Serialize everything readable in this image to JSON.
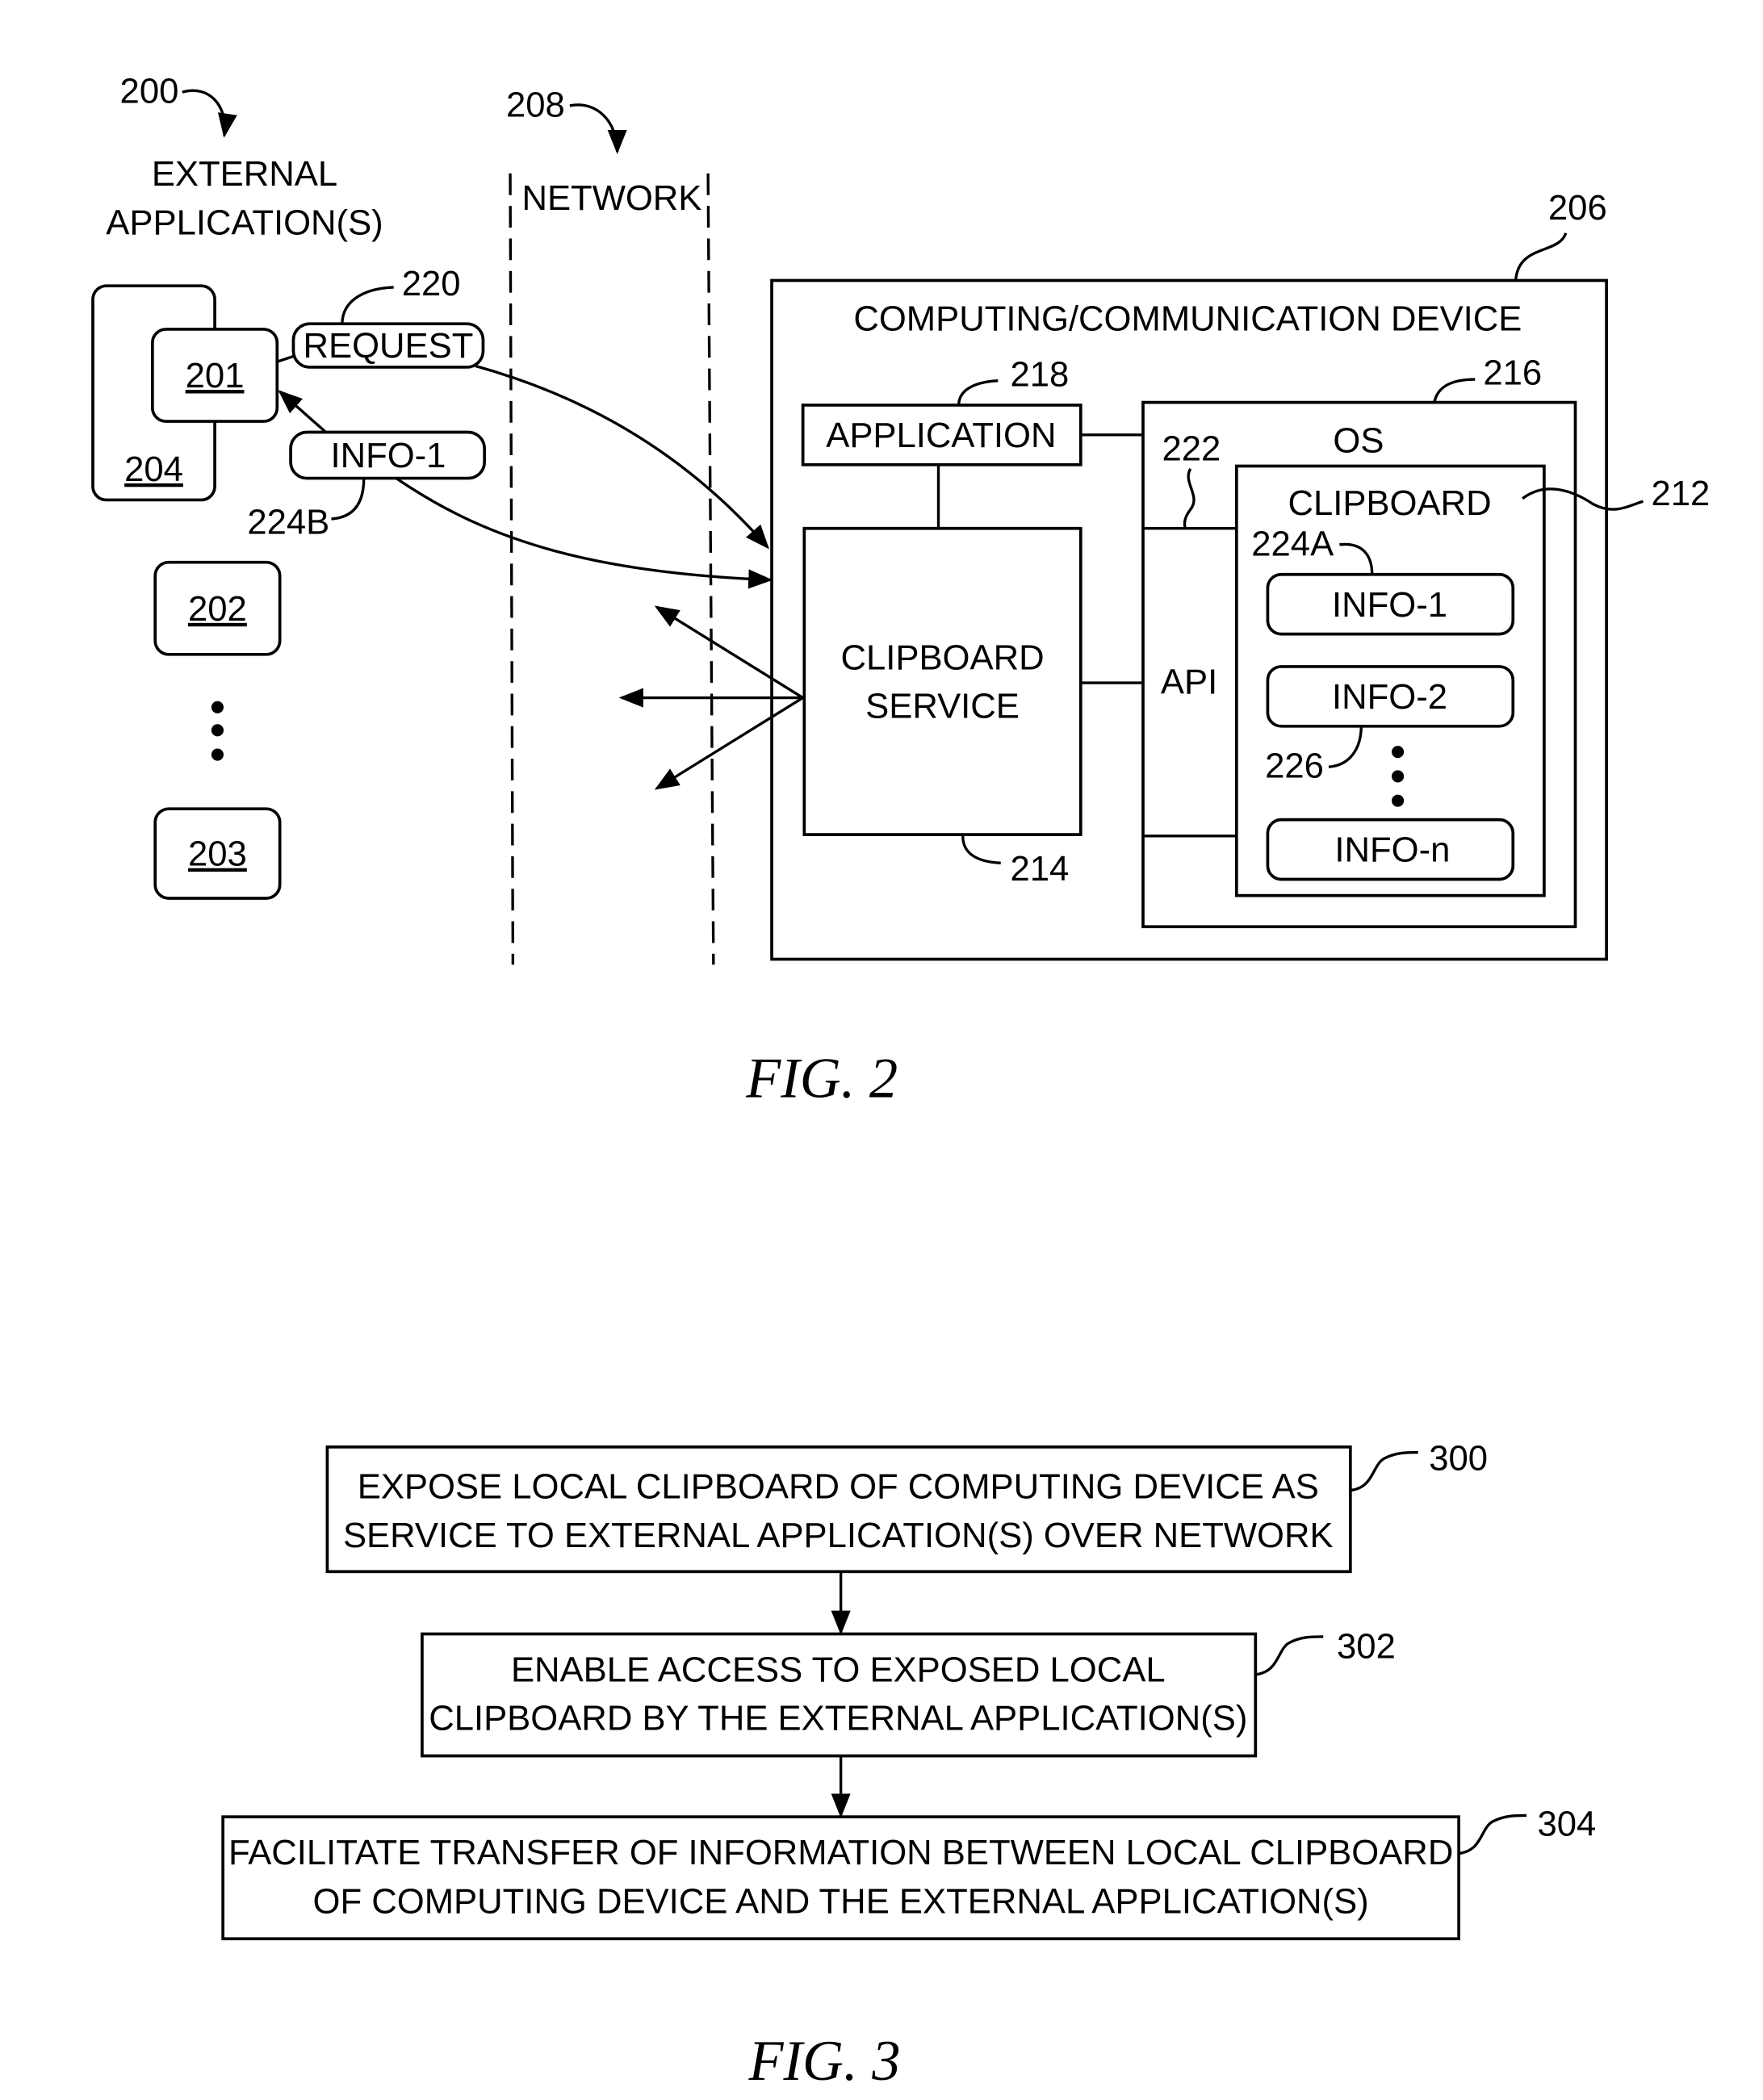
{
  "figure2": {
    "caption": "FIG. 2",
    "ref_external": "200",
    "external_title_line1": "EXTERNAL",
    "external_title_line2": "APPLICATION(S)",
    "ref_network": "208",
    "network_label": "NETWORK",
    "apps": [
      {
        "id": "201"
      },
      {
        "id": "202"
      },
      {
        "id": "203"
      }
    ],
    "container_ref": "204",
    "request_label": "REQUEST",
    "request_ref": "220",
    "info_msg_label": "INFO-1",
    "info_msg_ref": "224B",
    "device_ref": "206",
    "device_title": "COMPUTING/COMMUNICATION DEVICE",
    "application_label": "APPLICATION",
    "application_ref": "218",
    "os_label": "OS",
    "os_ref": "216",
    "api_ref": "222",
    "api_label": "API",
    "clipboard_label": "CLIPBOARD",
    "clipboard_ref": "212",
    "clipboard_service_line1": "CLIPBOARD",
    "clipboard_service_line2": "SERVICE",
    "clipboard_service_ref": "214",
    "clip_items": [
      {
        "label": "INFO-1"
      },
      {
        "label": "INFO-2"
      },
      {
        "label": "INFO-n"
      }
    ],
    "clip_item_ref_a": "224A",
    "clip_item_ref_b": "226"
  },
  "figure3": {
    "caption": "FIG. 3",
    "steps": [
      {
        "ref": "300",
        "line1": "EXPOSE LOCAL CLIPBOARD OF COMPUTING DEVICE AS",
        "line2": "SERVICE TO EXTERNAL APPLICATION(S) OVER NETWORK"
      },
      {
        "ref": "302",
        "line1": "ENABLE ACCESS TO EXPOSED LOCAL",
        "line2": "CLIPBOARD BY THE EXTERNAL APPLICATION(S)"
      },
      {
        "ref": "304",
        "line1": "FACILITATE TRANSFER OF INFORMATION BETWEEN LOCAL CLIPBOARD",
        "line2": "OF COMPUTING DEVICE AND THE EXTERNAL APPLICATION(S)"
      }
    ]
  }
}
